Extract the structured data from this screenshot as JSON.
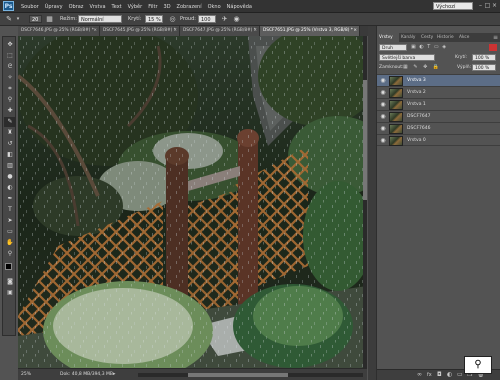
{
  "app": {
    "logo": "Ps"
  },
  "menu": [
    "Soubor",
    "Úpravy",
    "Obraz",
    "Vrstva",
    "Text",
    "Výběr",
    "Filtr",
    "3D",
    "Zobrazení",
    "Okno",
    "Nápověda"
  ],
  "workspace": {
    "selected": "Výchozí"
  },
  "options": {
    "brush_size": "20",
    "mode_label": "Režim:",
    "mode_value": "Normální",
    "opacity_label": "Krytí:",
    "opacity_value": "15 %",
    "flow_label": "Proud:",
    "flow_value": "100 %"
  },
  "tabs": [
    {
      "label": "DSCF7646.JPG @ 25% (RGB/8#) *",
      "close": "×"
    },
    {
      "label": "DSCF7645.JPG @ 25% (RGB/8#) *",
      "close": "×"
    },
    {
      "label": "DSCF7647.JPG @ 25% (RGB/8#) *",
      "close": "×"
    },
    {
      "label": "DSCF7651.JPG @ 25% (Vrstva 3, RGB/8) *",
      "close": "×"
    }
  ],
  "status": {
    "zoom": "25%",
    "doc": "Dok: 40,8 MB/394,3 MB"
  },
  "panel": {
    "tabs": [
      "Vrstvy",
      "Kanály",
      "Cesty",
      "Historie",
      "Akce"
    ],
    "filter_label": "Druh",
    "blend_mode": "Světlejší barva",
    "opacity_label": "Krytí:",
    "opacity_value": "100 %",
    "lock_label": "Zamknout:",
    "fill_label": "Výplň:",
    "fill_value": "100 %",
    "layers": [
      "Vrstva 3",
      "Vrstva 2",
      "Vrstva 1",
      "DSCF7647",
      "DSCF7646",
      "Vrstva 0"
    ],
    "active_layer_index": 0
  },
  "icons": {
    "eye": "eye-icon",
    "link": "link-icon",
    "fx": "fx-icon",
    "mask": "mask-icon",
    "new_layer": "new-layer-icon",
    "trash": "trash-icon"
  }
}
